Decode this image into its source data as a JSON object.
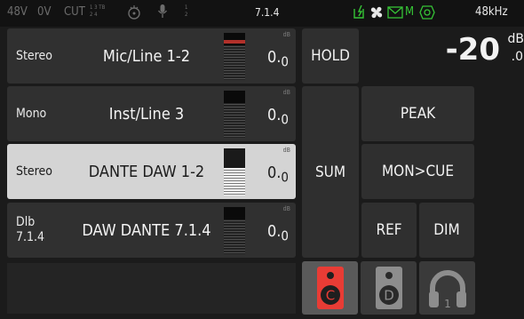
{
  "status_bar": {
    "phantom": "48V",
    "zero": "0V",
    "cut": "CUT",
    "cut_fraction_top": "1 3 TB",
    "cut_fraction_bottom": "2 4",
    "mic_fraction_top": "1",
    "mic_fraction_bottom": "2",
    "format": "7.1.4",
    "m_label": "M",
    "sample_rate": "48kHz",
    "colors": {
      "dim": "#6c6c6c",
      "green": "#36c336",
      "text": "#e8e8e8"
    }
  },
  "channels": [
    {
      "type": "Stereo",
      "name": "Mic/Line 1-2",
      "db_label": "dB",
      "value": "0.",
      "value_sub": "0",
      "selected": false
    },
    {
      "type": "Mono",
      "name": "Inst/Line 3",
      "db_label": "dB",
      "value": "0.",
      "value_sub": "0",
      "selected": false
    },
    {
      "type": "Stereo",
      "name": "DANTE DAW 1-2",
      "db_label": "dB",
      "value": "0.",
      "value_sub": "0",
      "selected": true
    },
    {
      "type_line1": "Dlb",
      "type_line2": "7.1.4",
      "name": "DAW DANTE 7.1.4",
      "db_label": "dB",
      "value": "0.",
      "value_sub": "0",
      "selected": false
    }
  ],
  "buttons": {
    "hold": "HOLD",
    "sum": "SUM",
    "peak": "PEAK",
    "mon_cue": "MON>CUE",
    "ref": "REF",
    "dim": "DIM"
  },
  "level": {
    "value": "-20",
    "unit_top": "dB",
    "unit_bottom": ".0"
  },
  "speakers": [
    {
      "letter": "C",
      "active": true,
      "color": "#e83c35"
    },
    {
      "letter": "D",
      "active": false,
      "color": "#8d8d8d"
    }
  ],
  "headphone": {
    "number": "1"
  }
}
